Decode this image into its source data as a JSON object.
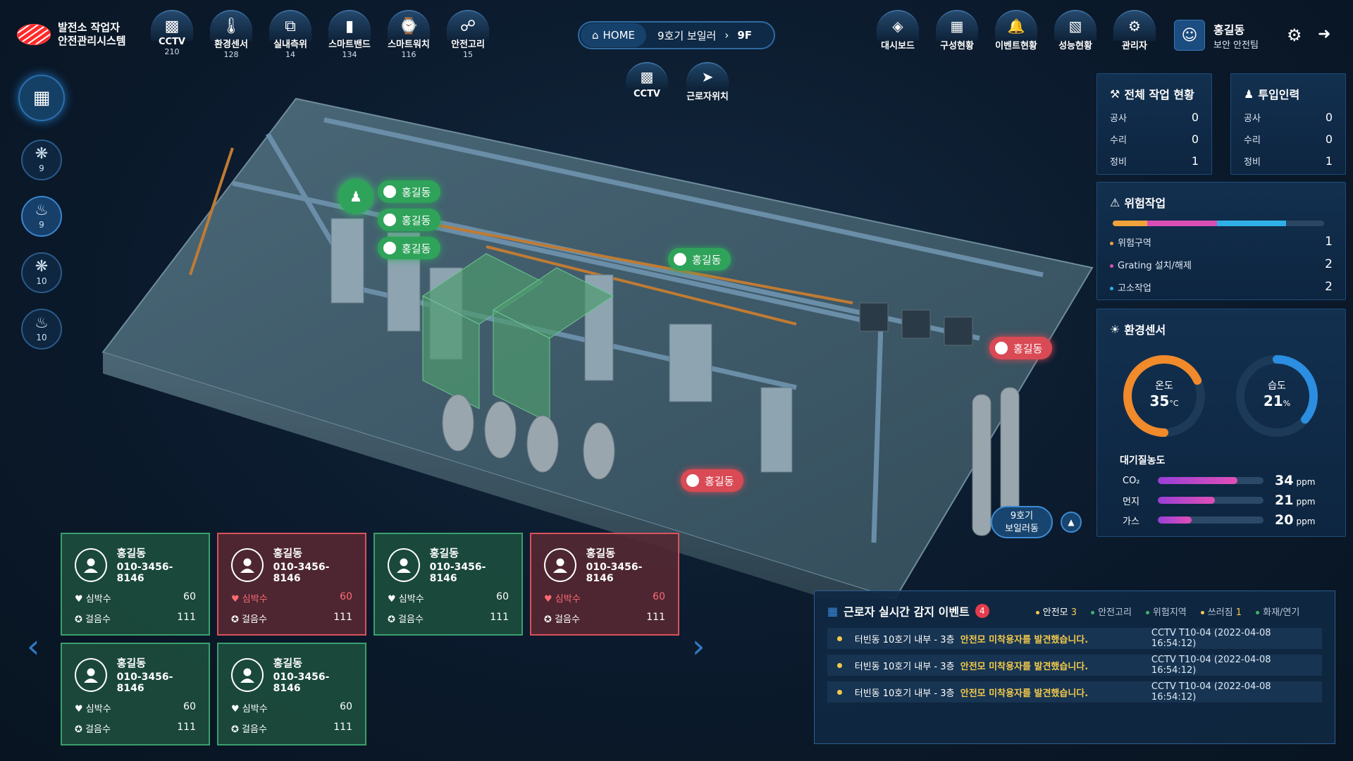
{
  "brand": {
    "line1": "발전소 작업자",
    "line2": "안전관리시스템"
  },
  "top_sensors": [
    {
      "label": "CCTV",
      "count": "210",
      "icon": "cctv-icon"
    },
    {
      "label": "환경센서",
      "count": "128",
      "icon": "thermometer-icon"
    },
    {
      "label": "실내측위",
      "count": "14",
      "icon": "signal-icon"
    },
    {
      "label": "스마트밴드",
      "count": "134",
      "icon": "band-icon"
    },
    {
      "label": "스마트워치",
      "count": "116",
      "icon": "watch-icon"
    },
    {
      "label": "안전고리",
      "count": "15",
      "icon": "hook-icon"
    }
  ],
  "breadcrumb": {
    "home": "HOME",
    "location": "9호기 보일러",
    "floor": "9F"
  },
  "top_nav": [
    {
      "label": "대시보드",
      "icon": "layers-icon"
    },
    {
      "label": "구성현황",
      "icon": "grid-icon"
    },
    {
      "label": "이벤트현황",
      "icon": "bell-icon"
    },
    {
      "label": "성능현황",
      "icon": "bar-chart-icon"
    },
    {
      "label": "관리자",
      "icon": "admin-icon"
    }
  ],
  "user": {
    "name": "홍길동",
    "team": "보안 안전팀"
  },
  "sub_nav": [
    {
      "label": "CCTV",
      "icon": "cctv-icon"
    },
    {
      "label": "근로자위치",
      "icon": "location-arrow-icon"
    }
  ],
  "sidebar": {
    "items": [
      {
        "icon": "fan-icon",
        "count": "9",
        "active": false
      },
      {
        "icon": "flame-icon",
        "count": "9",
        "active": true
      },
      {
        "icon": "fan-icon",
        "count": "10",
        "active": false
      },
      {
        "icon": "flame-icon",
        "count": "10",
        "active": false
      }
    ]
  },
  "plant": {
    "markers": [
      {
        "name": "홍길동",
        "status": "normal"
      },
      {
        "name": "홍길동",
        "status": "normal"
      },
      {
        "name": "홍길동",
        "status": "normal"
      },
      {
        "name": "홍길동",
        "status": "normal"
      },
      {
        "name": "홍길동",
        "status": "alert"
      },
      {
        "name": "홍길동",
        "status": "alert"
      }
    ],
    "building_label_1": "9호기",
    "building_label_2": "보일러동"
  },
  "work_status": {
    "title": "전체 작업 현황",
    "rows": [
      {
        "k": "공사",
        "v": "0"
      },
      {
        "k": "수리",
        "v": "0"
      },
      {
        "k": "정비",
        "v": "1"
      }
    ]
  },
  "crew": {
    "title": "투입인력",
    "rows": [
      {
        "k": "공사",
        "v": "0"
      },
      {
        "k": "수리",
        "v": "0"
      },
      {
        "k": "정비",
        "v": "1"
      }
    ]
  },
  "danger": {
    "title": "위험작업",
    "rows": [
      {
        "k": "위험구역",
        "v": "1",
        "color": "#f2a23a"
      },
      {
        "k": "Grating 설치/해제",
        "v": "2",
        "color": "#d94fb5"
      },
      {
        "k": "고소작업",
        "v": "2",
        "color": "#2fb1e8"
      }
    ]
  },
  "env": {
    "title": "환경센서",
    "temp_label": "온도",
    "temp_value": "35",
    "temp_unit": "°C",
    "temp_fraction": 0.68,
    "hum_label": "습도",
    "hum_value": "21",
    "hum_unit": "%",
    "hum_fraction": 0.36,
    "aq_title": "대기질농도",
    "aq": [
      {
        "name": "CO₂",
        "value": "34",
        "unit": "ppm",
        "fraction": 0.75
      },
      {
        "name": "먼지",
        "value": "21",
        "unit": "ppm",
        "fraction": 0.54
      },
      {
        "name": "가스",
        "value": "20",
        "unit": "ppm",
        "fraction": 0.32
      }
    ]
  },
  "workers": {
    "heart_label": "심박수",
    "steps_label": "걸음수",
    "cards": [
      {
        "name": "홍길동",
        "phone": "010-3456-8146",
        "heart": "60",
        "steps": "111",
        "status": "normal"
      },
      {
        "name": "홍길동",
        "phone": "010-3456-8146",
        "heart": "60",
        "steps": "111",
        "status": "alert"
      },
      {
        "name": "홍길동",
        "phone": "010-3456-8146",
        "heart": "60",
        "steps": "111",
        "status": "normal"
      },
      {
        "name": "홍길동",
        "phone": "010-3456-8146",
        "heart": "60",
        "steps": "111",
        "status": "alert"
      },
      {
        "name": "홍길동",
        "phone": "010-3456-8146",
        "heart": "60",
        "steps": "111",
        "status": "normal"
      },
      {
        "name": "홍길동",
        "phone": "010-3456-8146",
        "heart": "60",
        "steps": "111",
        "status": "normal"
      }
    ]
  },
  "events": {
    "title": "근로자 실시간 감지 이벤트",
    "badge": "4",
    "tabs": [
      {
        "label": "안전모",
        "count": "3",
        "color": "#f2c94c",
        "selected": true
      },
      {
        "label": "안전고리",
        "count": "",
        "color": "#3fb36a",
        "selected": false
      },
      {
        "label": "위험지역",
        "count": "",
        "color": "#3fb36a",
        "selected": false
      },
      {
        "label": "쓰러짐",
        "count": "1",
        "color": "#f2c94c",
        "selected": false
      },
      {
        "label": "화재/연기",
        "count": "",
        "color": "#3fb36a",
        "selected": false
      }
    ],
    "rows": [
      {
        "loc": "터빈동 10호기 내부 - 3층",
        "msg": "안전모 미착용자를 발견했습니다.",
        "src": "CCTV T10-04 (2022-04-08 16:54:12)"
      },
      {
        "loc": "터빈동 10호기 내부 - 3층",
        "msg": "안전모 미착용자를 발견했습니다.",
        "src": "CCTV T10-04 (2022-04-08 16:54:12)"
      },
      {
        "loc": "터빈동 10호기 내부 - 3층",
        "msg": "안전모 미착용자를 발견했습니다.",
        "src": "CCTV T10-04 (2022-04-08 16:54:12)"
      }
    ]
  }
}
